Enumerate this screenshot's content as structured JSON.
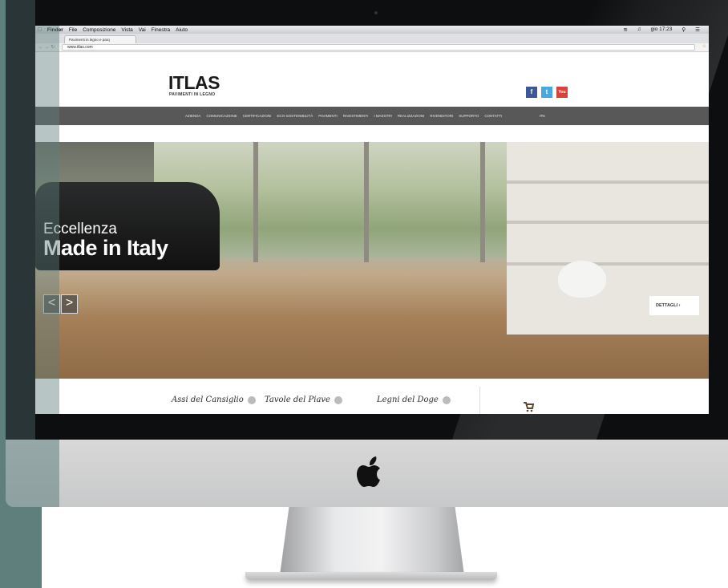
{
  "os_menubar": {
    "app": "Finder",
    "items": [
      "File",
      "Composizione",
      "Vista",
      "Vai",
      "Finestra",
      "Aiuto"
    ],
    "clock": "gio 17:23"
  },
  "browser": {
    "tab_title": "Pavimenti in legno e parq",
    "url": "www.itlas.com"
  },
  "site": {
    "logo": "ITLAS",
    "logo_sub": "PAVIMENTI IN LEGNO",
    "social": [
      "f",
      "t",
      "You"
    ],
    "nav": [
      "AZIENDA",
      "COMUNICAZIONE",
      "CERTIFICAZIONI",
      "ECO-SOSTENIBILITÀ",
      "PAVIMENTI",
      "RIVESTIMENTI",
      "I MAESTRI",
      "REALIZZAZIONI",
      "RIVENDITORI",
      "SUPPORTO",
      "CONTATTI"
    ],
    "lang": "ITA",
    "hero": {
      "line1": "Eccellenza",
      "line2": "Made in Italy",
      "prev": "<",
      "next": ">",
      "details_label": "DETTAGLI"
    },
    "brands": [
      "Assi del Cansiglio",
      "Tavole del Piave",
      "Legni del Doge"
    ]
  },
  "colors": {
    "teal": "#5f7f7d",
    "nav_bg": "#585858",
    "facebook": "#3b5998",
    "twitter": "#4aa8e0",
    "youtube": "#d9433a"
  }
}
